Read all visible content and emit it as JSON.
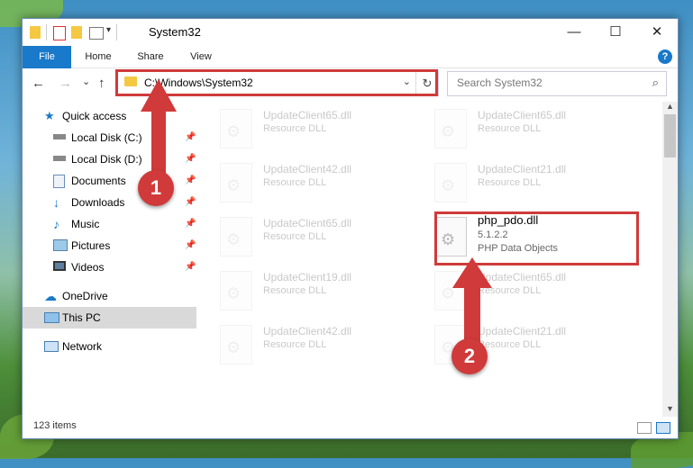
{
  "window": {
    "title": "System32"
  },
  "controls": {
    "minimize": "—",
    "maximize": "☐",
    "close": "✕"
  },
  "ribbon": {
    "tabs": [
      "File",
      "Home",
      "Share",
      "View"
    ],
    "help": "?"
  },
  "nav": {
    "back": "←",
    "forward": "→",
    "recent": "⌄",
    "up": "↑"
  },
  "address": {
    "path": "C:\\Windows\\System32",
    "dropdown": "⌄",
    "refresh": "↻"
  },
  "search": {
    "placeholder": "Search System32",
    "icon": "⌕"
  },
  "sidebar": {
    "items": [
      {
        "label": "Quick access",
        "icon": "star-icon"
      },
      {
        "label": "Local Disk (C:)",
        "icon": "drive-icon",
        "pinned": true
      },
      {
        "label": "Local Disk (D:)",
        "icon": "drive-icon",
        "pinned": true
      },
      {
        "label": "Documents",
        "icon": "documents-icon",
        "pinned": true
      },
      {
        "label": "Downloads",
        "icon": "downloads-icon",
        "pinned": true
      },
      {
        "label": "Music",
        "icon": "music-icon",
        "pinned": true
      },
      {
        "label": "Pictures",
        "icon": "pictures-icon",
        "pinned": true
      },
      {
        "label": "Videos",
        "icon": "videos-icon",
        "pinned": true
      },
      {
        "label": "OneDrive",
        "icon": "cloud-icon"
      },
      {
        "label": "This PC",
        "icon": "computer-icon",
        "selected": true
      },
      {
        "label": "Network",
        "icon": "network-icon"
      }
    ],
    "pin_glyph": "📌"
  },
  "files": [
    {
      "name": "UpdateClient65.dll",
      "desc": "Resource DLL"
    },
    {
      "name": "UpdateClient65.dll",
      "desc": "Resource DLL"
    },
    {
      "name": "UpdateClient42.dll",
      "desc": "Resource DLL"
    },
    {
      "name": "UpdateClient21.dll",
      "desc": "Resource DLL"
    },
    {
      "name": "UpdateClient65.dll",
      "desc": "Resource DLL"
    },
    {
      "name": "php_pdo.dll",
      "version": "5.1.2.2",
      "desc": "PHP Data Objects"
    },
    {
      "name": "UpdateClient19.dll",
      "desc": "Resource DLL"
    },
    {
      "name": "UpdateClient65.dll",
      "desc": "Resource DLL"
    },
    {
      "name": "UpdateClient42.dll",
      "desc": "Resource DLL"
    },
    {
      "name": "UpdateClient21.dll",
      "desc": "Resource DLL"
    }
  ],
  "status": {
    "count": "123 items"
  },
  "callouts": [
    "1",
    "2"
  ],
  "colors": {
    "accent": "#1979ca",
    "highlight": "#d03a3a",
    "folder": "#f5c842"
  }
}
